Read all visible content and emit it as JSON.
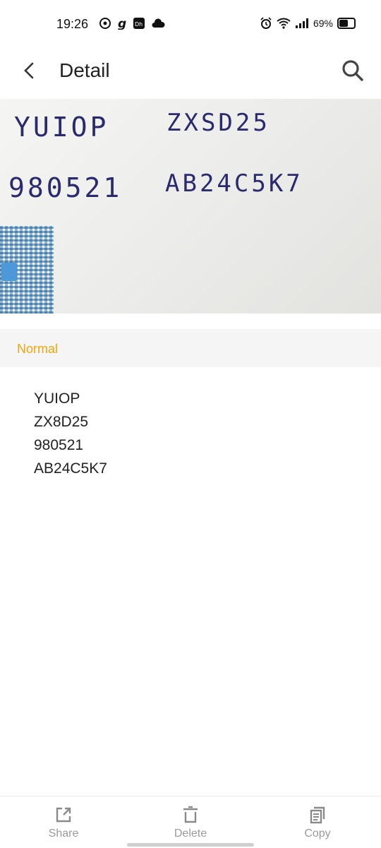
{
  "status_bar": {
    "time": "19:26",
    "battery": "69%",
    "battery_level": 0.69
  },
  "app_bar": {
    "title": "Detail"
  },
  "photo": {
    "handwriting": [
      "YUIOP",
      "ZXSD25",
      "980521",
      "AB24C5K7"
    ]
  },
  "mode": {
    "label": "Normal",
    "accent_color": "#f2a60c"
  },
  "results": {
    "lines": [
      "YUIOP",
      "ZX8D25",
      "980521",
      "AB24C5K7"
    ]
  },
  "toolbar": {
    "share_label": "Share",
    "delete_label": "Delete",
    "copy_label": "Copy"
  }
}
